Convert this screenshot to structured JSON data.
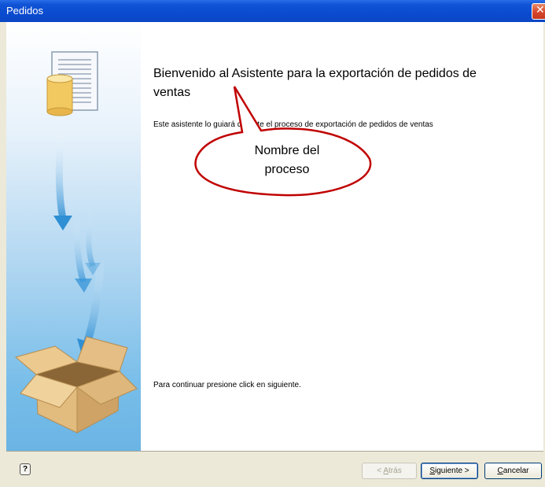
{
  "window": {
    "title": "Pedidos",
    "close_symbol": "✕"
  },
  "wizard": {
    "heading": "Bienvenido al Asistente para la exportación de pedidos de ventas",
    "description": "Este asistente lo guiará durante el proceso de exportación de pedidos de ventas",
    "continue_text": "Para continuar presione click en siguiente."
  },
  "callout": {
    "text_line1": "Nombre del",
    "text_line2": "proceso",
    "border_color": "#c00000"
  },
  "sidebar": {
    "icons": [
      "document-database-icon",
      "arrow-down-icon",
      "open-box-icon"
    ]
  },
  "buttons": {
    "help": "?",
    "back_accel": "A",
    "back_rest": "trás",
    "back_prefix": "< ",
    "next_accel": "S",
    "next_rest": "iguiente >",
    "cancel_accel": "C",
    "cancel_rest": "ancelar"
  },
  "colors": {
    "titlebar": "#0a4bd0",
    "sidebar_gradient_bottom": "#6bb4e4",
    "callout_border": "#c00000"
  }
}
